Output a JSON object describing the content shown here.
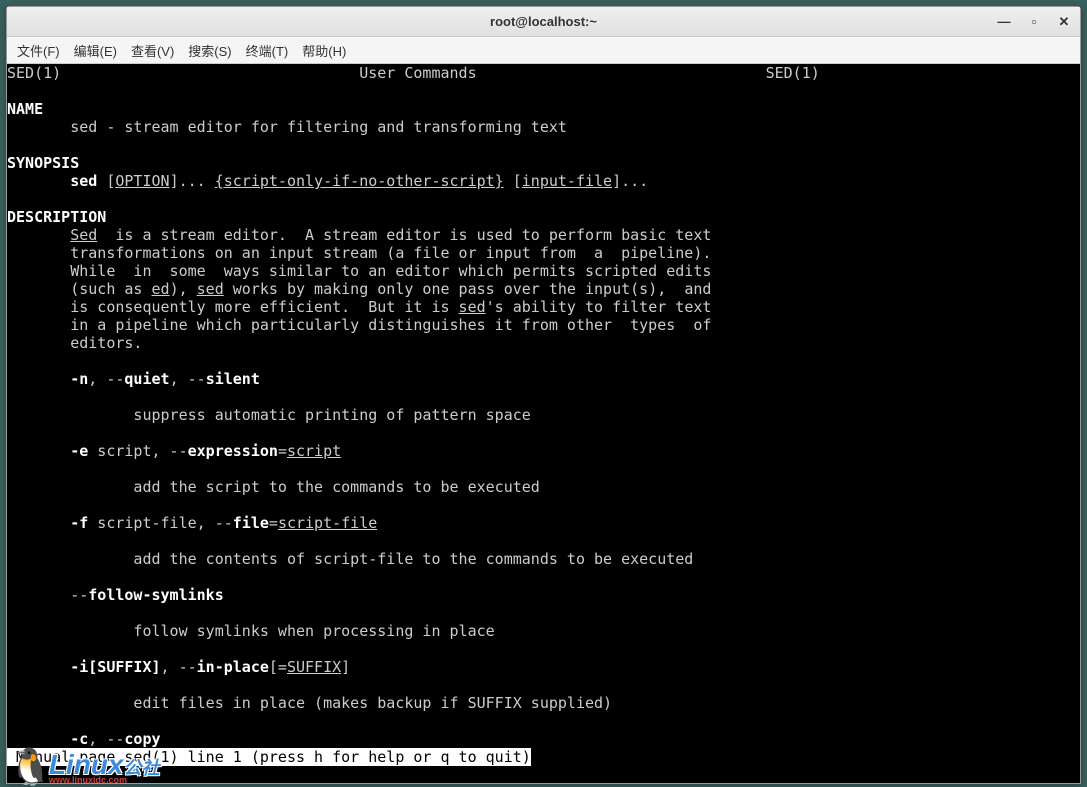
{
  "window": {
    "title": "root@localhost:~"
  },
  "menubar": {
    "items": [
      "文件(F)",
      "编辑(E)",
      "查看(V)",
      "搜索(S)",
      "终端(T)",
      "帮助(H)"
    ]
  },
  "man": {
    "header_left": "SED(1)",
    "header_center": "User Commands",
    "header_right": "SED(1)",
    "name_hdr": "NAME",
    "name_line": "       sed - stream editor for filtering and transforming text",
    "synopsis_hdr": "SYNOPSIS",
    "syn_pre": "       ",
    "syn_cmd": "sed",
    "syn_after_cmd": " [",
    "syn_option": "OPTION",
    "syn_after_option": "]... ",
    "syn_script": "{script-only-if-no-other-script}",
    "syn_after_script": " [",
    "syn_file": "input-file",
    "syn_tail": "]...",
    "description_hdr": "DESCRIPTION",
    "desc_pre": "       ",
    "desc_sed": "Sed",
    "desc_l1_after": "  is a stream editor.  A stream editor is used to perform basic text",
    "desc_l2": "       transformations on an input stream (a file or input from  a  pipeline).",
    "desc_l3": "       While  in  some  ways similar to an editor which permits scripted edits",
    "desc_l4a": "       (such as ",
    "desc_ed": "ed",
    "desc_l4b": "), ",
    "desc_sed2": "sed",
    "desc_l4c": " works by making only one pass over the input(s),  and",
    "desc_l5a": "       is consequently more efficient.  But it is ",
    "desc_sed3": "sed",
    "desc_l5b": "'s ability to filter text",
    "desc_l6": "       in a pipeline which particularly distinguishes it from other  types  of",
    "desc_l7": "       editors.",
    "opt_n_pre": "       ",
    "opt_n_dash": "-",
    "opt_n_n": "n",
    "opt_n_c1": ", --",
    "opt_n_quiet": "quiet",
    "opt_n_c2": ", --",
    "opt_n_silent": "silent",
    "opt_n_desc": "              suppress automatic printing of pattern space",
    "opt_e_pre": "       ",
    "opt_e_dash": "-",
    "opt_e_e": "e",
    "opt_e_mid": " script, --",
    "opt_e_exp": "expression",
    "opt_e_eq": "=",
    "opt_e_script": "script",
    "opt_e_desc": "              add the script to the commands to be executed",
    "opt_f_pre": "       ",
    "opt_f_dash": "-",
    "opt_f_f": "f",
    "opt_f_mid": " script-file, --",
    "opt_f_file": "file",
    "opt_f_eq": "=",
    "opt_f_sf": "script-file",
    "opt_f_desc": "              add the contents of script-file to the commands to be executed",
    "opt_fs_pre": "       --",
    "opt_fs": "follow-symlinks",
    "opt_fs_desc": "              follow symlinks when processing in place",
    "opt_i_pre": "       ",
    "opt_i_dash": "-",
    "opt_i_i": "i[SUFFIX]",
    "opt_i_c": ", --",
    "opt_i_ip": "in-place",
    "opt_i_br": "[=",
    "opt_i_suf": "SUFFIX",
    "opt_i_brc": "]",
    "opt_i_desc": "              edit files in place (makes backup if SUFFIX supplied)",
    "opt_c_pre": "       ",
    "opt_c_dash": "-",
    "opt_c_c": "c",
    "opt_c_mid": ", --",
    "opt_c_copy": "copy",
    "status": " Manual page sed(1) line 1 (press h for help or q to quit)"
  },
  "watermark": {
    "brand": "Linux",
    "sub": "公社",
    "url": "www.linuxidc.com"
  }
}
